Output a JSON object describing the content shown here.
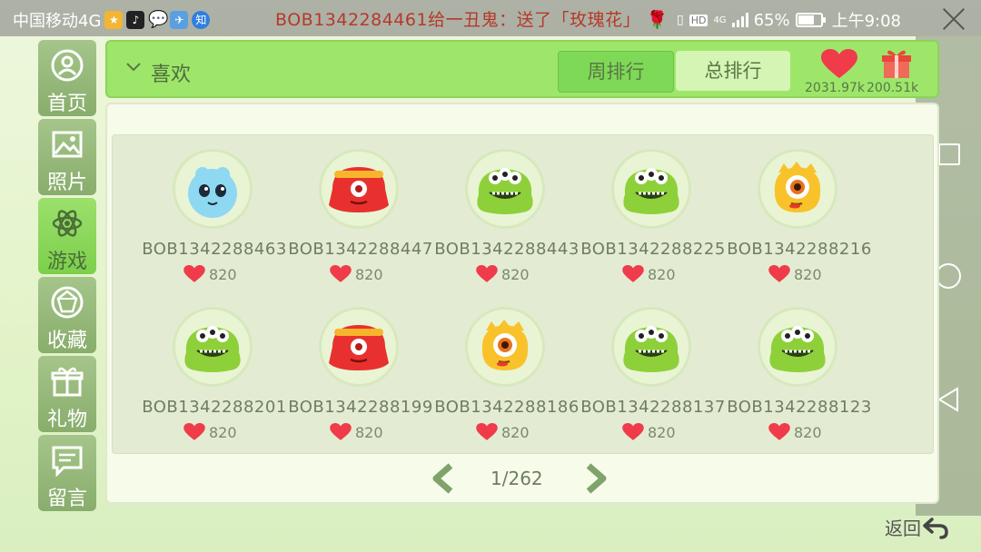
{
  "status_bar": {
    "carrier": "中国移动4G",
    "marquee": "BOB1342284461给一丑鬼：送了「玫瑰花」",
    "battery": "65%",
    "time": "上午9:08",
    "network": "4G",
    "hd": "HD"
  },
  "sidebar": {
    "items": [
      {
        "label": "首页",
        "icon": "home-icon"
      },
      {
        "label": "照片",
        "icon": "photo-icon"
      },
      {
        "label": "游戏",
        "icon": "atom-icon"
      },
      {
        "label": "收藏",
        "icon": "gem-icon"
      },
      {
        "label": "礼物",
        "icon": "gift-icon"
      },
      {
        "label": "留言",
        "icon": "message-icon"
      }
    ],
    "active_index": 2
  },
  "header": {
    "title": "喜欢",
    "tabs": [
      "周排行",
      "总排行"
    ],
    "active_tab": "周排行",
    "likes_count": "2031.97k",
    "gifts_count": "200.51k"
  },
  "users": [
    {
      "name": "BOB1342288463",
      "likes": "820",
      "avatar": "blue"
    },
    {
      "name": "BOB1342288447",
      "likes": "820",
      "avatar": "red"
    },
    {
      "name": "BOB1342288443",
      "likes": "820",
      "avatar": "green"
    },
    {
      "name": "BOB1342288225",
      "likes": "820",
      "avatar": "green"
    },
    {
      "name": "BOB1342288216",
      "likes": "820",
      "avatar": "yellow"
    },
    {
      "name": "BOB1342288201",
      "likes": "820",
      "avatar": "green"
    },
    {
      "name": "BOB1342288199",
      "likes": "820",
      "avatar": "red"
    },
    {
      "name": "BOB1342288186",
      "likes": "820",
      "avatar": "yellow"
    },
    {
      "name": "BOB1342288137",
      "likes": "820",
      "avatar": "green"
    },
    {
      "name": "BOB1342288123",
      "likes": "820",
      "avatar": "green"
    }
  ],
  "pager": {
    "text": "1/262"
  },
  "footer": {
    "back_label": "返回"
  },
  "colors": {
    "accent_green": "#9ee66a",
    "heart_red": "#f03b4a",
    "marquee_red": "#b5392b"
  }
}
